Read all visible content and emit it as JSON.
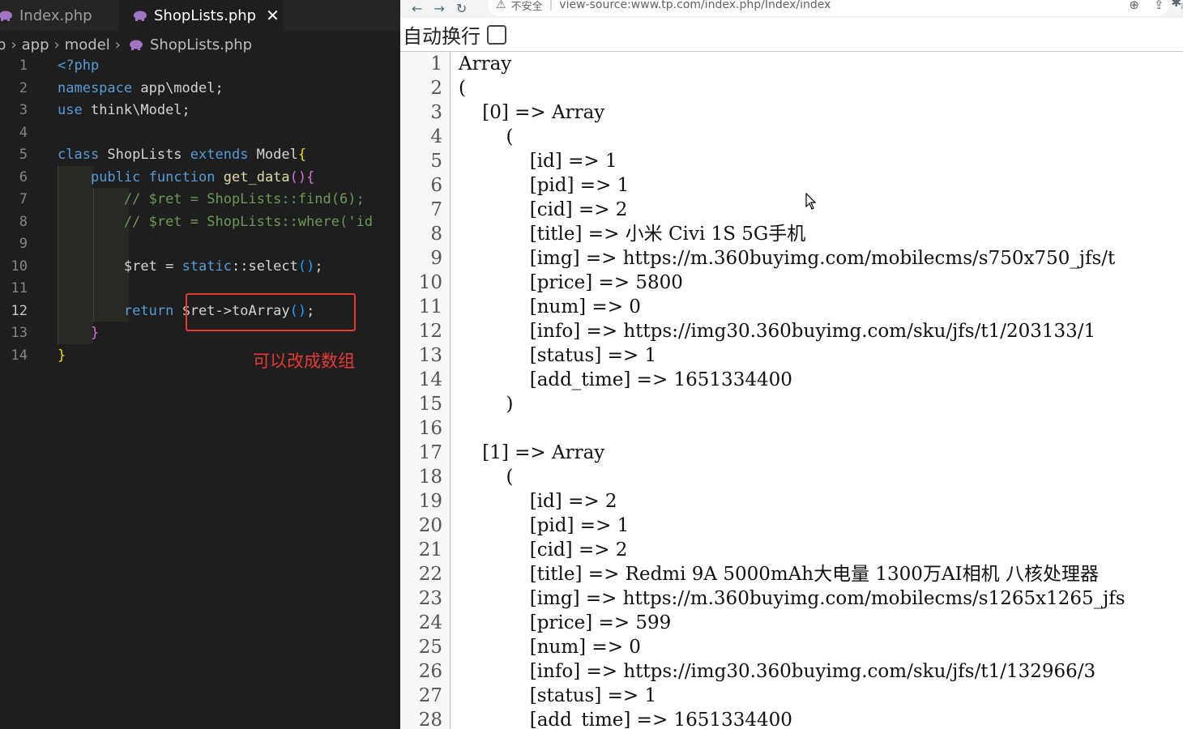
{
  "editor": {
    "tabs": [
      {
        "label": "Index.php",
        "active": false
      },
      {
        "label": "ShopLists.php",
        "active": true,
        "close_glyph": "✕"
      }
    ],
    "breadcrumb": [
      "p",
      "app",
      "model",
      "ShopLists.php"
    ],
    "current_line": 12,
    "line_numbers": [
      "1",
      "2",
      "3",
      "4",
      "5",
      "6",
      "7",
      "8",
      "9",
      "10",
      "11",
      "12",
      "13",
      "14"
    ],
    "code": {
      "l1_open": "<?php",
      "l2_kw": "namespace",
      "l2_ns": " app\\model;",
      "l3_kw": "use",
      "l3_ns": " think\\Model;",
      "l5_kw1": "class",
      "l5_cls": " ShopLists ",
      "l5_kw2": "extends",
      "l5_cls2": " Model",
      "l5_br": "{",
      "l6_kw1": "public",
      "l6_kw2": "function",
      "l6_fn": "get_data",
      "l6_p": "()",
      "l6_br": "{",
      "l7_comment": "// $ret = ShopLists::find(6);",
      "l8_comment": "// $ret = ShopLists::where('id",
      "l10_var": "$ret",
      "l10_eq": " = ",
      "l10_kw": "static",
      "l10_op": "::",
      "l10_fn": "select",
      "l10_p": "()",
      "l10_end": ";",
      "l12_kw": "return",
      "l12_var": "$ret",
      "l12_arrow": "->",
      "l12_fn": "toArray",
      "l12_p": "()",
      "l12_end": ";",
      "l13_br": "}",
      "l14_br": "}"
    },
    "annotation": "可以改成数组",
    "colors": {
      "annotation": "#e53935",
      "background": "#1e1e1e"
    }
  },
  "browser": {
    "insecure_label": "不安全",
    "url": "view-source:www.tp.com/index.php/Index/index",
    "wrap_label": "自动换行",
    "wrap_checked": false,
    "source_lines": [
      {
        "n": "1",
        "t": "Array"
      },
      {
        "n": "2",
        "t": "("
      },
      {
        "n": "3",
        "t": "    [0] => Array"
      },
      {
        "n": "4",
        "t": "        ("
      },
      {
        "n": "5",
        "t": "            [id] => 1"
      },
      {
        "n": "6",
        "t": "            [pid] => 1"
      },
      {
        "n": "7",
        "t": "            [cid] => 2"
      },
      {
        "n": "8",
        "t": "            [title] => 小米 Civi 1S 5G手机"
      },
      {
        "n": "9",
        "t": "            [img] => https://m.360buyimg.com/mobilecms/s750x750_jfs/t"
      },
      {
        "n": "10",
        "t": "            [price] => 5800"
      },
      {
        "n": "11",
        "t": "            [num] => 0"
      },
      {
        "n": "12",
        "t": "            [info] => https://img30.360buyimg.com/sku/jfs/t1/203133/1"
      },
      {
        "n": "13",
        "t": "            [status] => 1"
      },
      {
        "n": "14",
        "t": "            [add_time] => 1651334400"
      },
      {
        "n": "15",
        "t": "        )"
      },
      {
        "n": "16",
        "t": ""
      },
      {
        "n": "17",
        "t": "    [1] => Array"
      },
      {
        "n": "18",
        "t": "        ("
      },
      {
        "n": "19",
        "t": "            [id] => 2"
      },
      {
        "n": "20",
        "t": "            [pid] => 1"
      },
      {
        "n": "21",
        "t": "            [cid] => 2"
      },
      {
        "n": "22",
        "t": "            [title] => Redmi 9A 5000mAh大电量 1300万AI相机 八核处理器"
      },
      {
        "n": "23",
        "t": "            [img] => https://m.360buyimg.com/mobilecms/s1265x1265_jfs"
      },
      {
        "n": "24",
        "t": "            [price] => 599"
      },
      {
        "n": "25",
        "t": "            [num] => 0"
      },
      {
        "n": "26",
        "t": "            [info] => https://img30.360buyimg.com/sku/jfs/t1/132966/3"
      },
      {
        "n": "27",
        "t": "            [status] => 1"
      },
      {
        "n": "28",
        "t": "            [add_time] => 1651334400"
      }
    ]
  }
}
